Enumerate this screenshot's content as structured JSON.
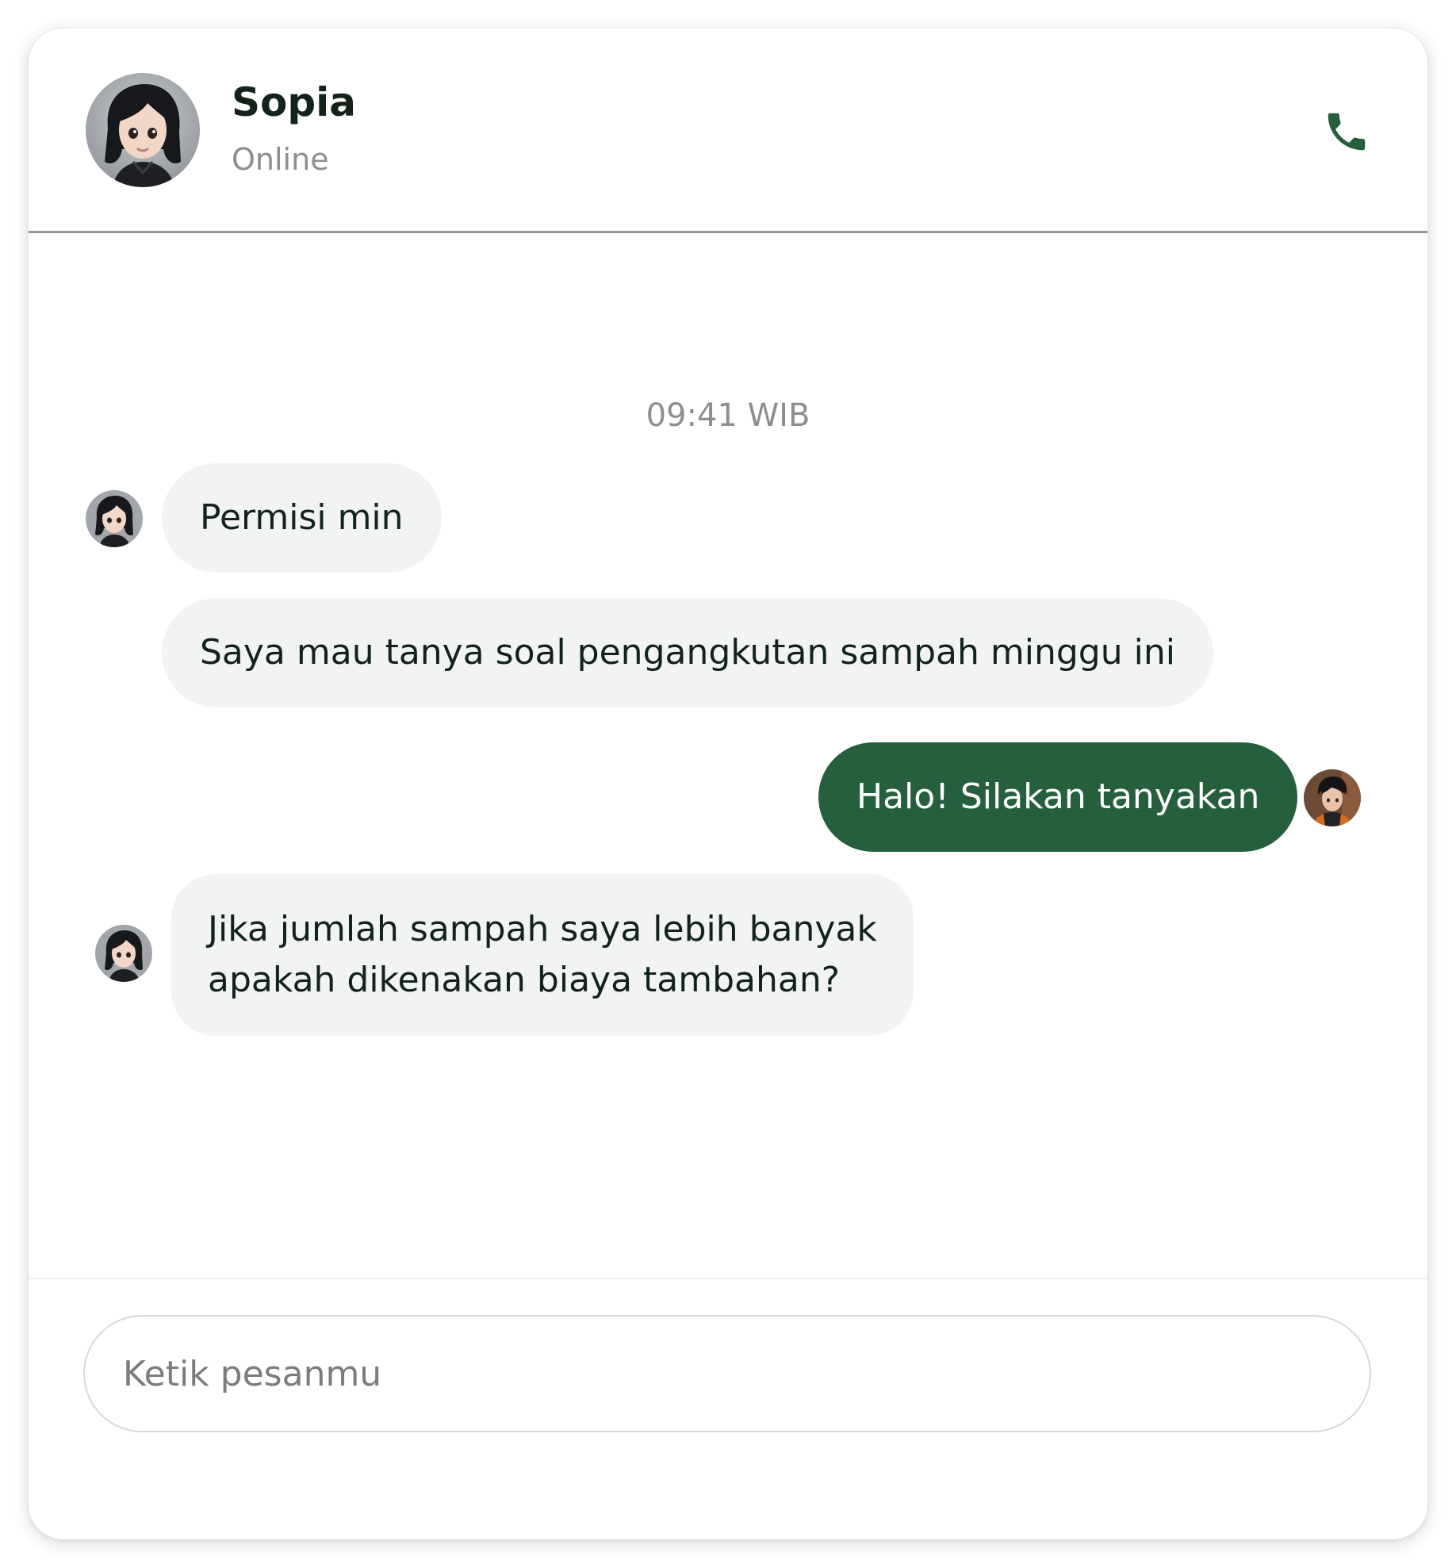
{
  "header": {
    "contact_name": "Sopia",
    "contact_status": "Online",
    "call_icon": "phone-icon"
  },
  "chat": {
    "timestamp": "09:41 WIB",
    "messages": [
      {
        "direction": "incoming",
        "text": "Permisi min",
        "avatar": "sopia-avatar"
      },
      {
        "direction": "incoming",
        "text": "Saya mau tanya soal pengangkutan sampah minggu ini"
      },
      {
        "direction": "outgoing",
        "text": "Halo! Silakan tanyakan",
        "avatar": "admin-avatar"
      },
      {
        "direction": "incoming",
        "lines": [
          "Jika jumlah sampah saya lebih banyak",
          "apakah dikenakan biaya tambahan?"
        ],
        "avatar": "sopia-avatar"
      }
    ]
  },
  "composer": {
    "placeholder": "Ketik pesanmu",
    "value": ""
  },
  "colors": {
    "accent": "#265f3c",
    "incoming_bubble": "#f2f3f5",
    "text": "#12241a",
    "muted": "#8e8e8e"
  }
}
